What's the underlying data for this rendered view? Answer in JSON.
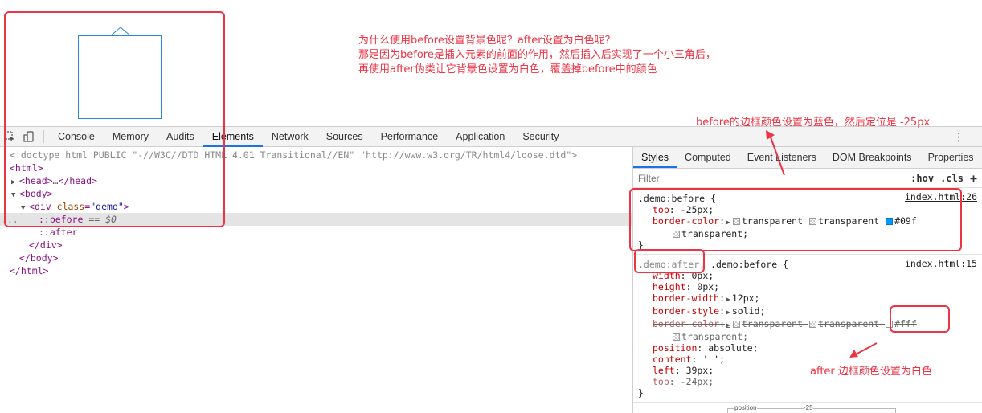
{
  "annotations": {
    "question_lines": [
      "为什么使用before设置背景色呢？after设置为白色呢？",
      "那是因为before是插入元素的前面的作用，然后插入后实现了一个小三角后，",
      "再使用after伪类让它背景色设置为白色，覆盖掉before中的颜色"
    ],
    "before_note": "before的边框颜色设置为蓝色，然后定位是 -25px",
    "after_note": "after 边框颜色设置为白色"
  },
  "toolbar": {
    "tabs": [
      "Console",
      "Memory",
      "Audits",
      "Elements",
      "Network",
      "Sources",
      "Performance",
      "Application",
      "Security"
    ],
    "active_tab": "Elements"
  },
  "dom": {
    "doctype": "<!doctype html PUBLIC \"-//W3C//DTD HTML 4.01 Transitional//EN\" \"http://www.w3.org/TR/html4/loose.dtd\">",
    "html_open": "<html>",
    "head_open": "<head>",
    "head_ellipsis": "…",
    "head_close": "</head>",
    "body_open": "<body>",
    "div_tag": "div",
    "div_attr_name": "class",
    "div_attr_value": "demo",
    "before": "::before",
    "selected_marker": "== $0",
    "after": "::after",
    "div_close": "</div>",
    "body_close": "</body>",
    "html_close": "</html>",
    "dots": "..."
  },
  "styles": {
    "tabs": [
      "Styles",
      "Computed",
      "Event Listeners",
      "DOM Breakpoints",
      "Properties"
    ],
    "close_glyph": "×",
    "active_tab": "Styles",
    "filter_placeholder": "Filter",
    "hov": ":hov",
    "cls": ".cls",
    "plus": "+",
    "rule1": {
      "selector": ".demo:before {",
      "source": "index.html:26",
      "top_name": "top",
      "top_value": "-25px;",
      "bc_name": "border-color",
      "bc_v1": "transparent",
      "bc_v2": "transparent",
      "bc_v3": "#09f",
      "bc_v4": "transparent;",
      "close": "}"
    },
    "rule2": {
      "selector_a": ".demo:after,",
      "selector_b": ".demo:before {",
      "source": "index.html:15",
      "props": [
        {
          "name": "width",
          "value": "0px;"
        },
        {
          "name": "height",
          "value": "0px;"
        },
        {
          "name": "border-width",
          "value": "12px;"
        },
        {
          "name": "border-style",
          "value": "solid;"
        }
      ],
      "bc_name": "border-color",
      "bc_v1": "transparent",
      "bc_v2": "transparent",
      "bc_v3": "#fff",
      "bc_v4": "transparent;",
      "props2": [
        {
          "name": "position",
          "value": "absolute;"
        },
        {
          "name": "content",
          "value": "' ';"
        },
        {
          "name": "left",
          "value": "39px;"
        }
      ],
      "top_name": "top",
      "top_value": "-24px;",
      "close": "}"
    },
    "box_model_label": "position",
    "box_model_value": "-25"
  },
  "colors": {
    "annotation": "#ee3344",
    "accent": "#1a73e8",
    "demo_border": "#2b8bd6",
    "blue_swatch": "#0099ff"
  }
}
